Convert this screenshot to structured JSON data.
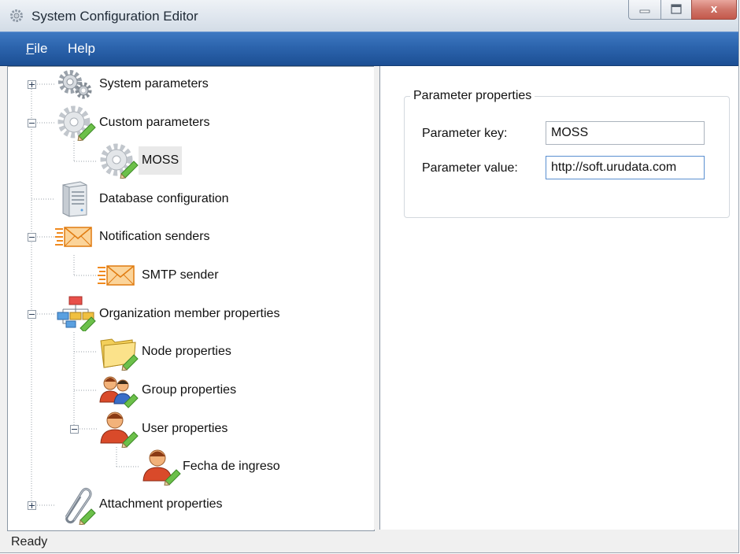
{
  "window": {
    "title": "System Configuration Editor",
    "close_glyph": "x"
  },
  "menu": {
    "file_mnemonic": "F",
    "file_rest": "ile",
    "help": "Help"
  },
  "tree": {
    "system_parameters": "System parameters",
    "custom_parameters": "Custom parameters",
    "moss": "MOSS",
    "database_configuration": "Database configuration",
    "notification_senders": "Notification senders",
    "smtp_sender": "SMTP sender",
    "organization_member_properties": "Organization member properties",
    "node_properties": "Node properties",
    "group_properties": "Group properties",
    "user_properties": "User properties",
    "fecha_de_ingreso": "Fecha de ingreso",
    "attachment_properties": "Attachment properties"
  },
  "properties": {
    "group_title": "Parameter properties",
    "key_label": "Parameter key:",
    "key_value": "MOSS",
    "value_label": "Parameter value:",
    "value_value": "http://soft.urudata.com"
  },
  "status": {
    "text": "Ready"
  },
  "colors": {
    "menubar": "#2c64ad",
    "selection": "#e9e9e9",
    "tree_line": "#9aa0a8"
  }
}
